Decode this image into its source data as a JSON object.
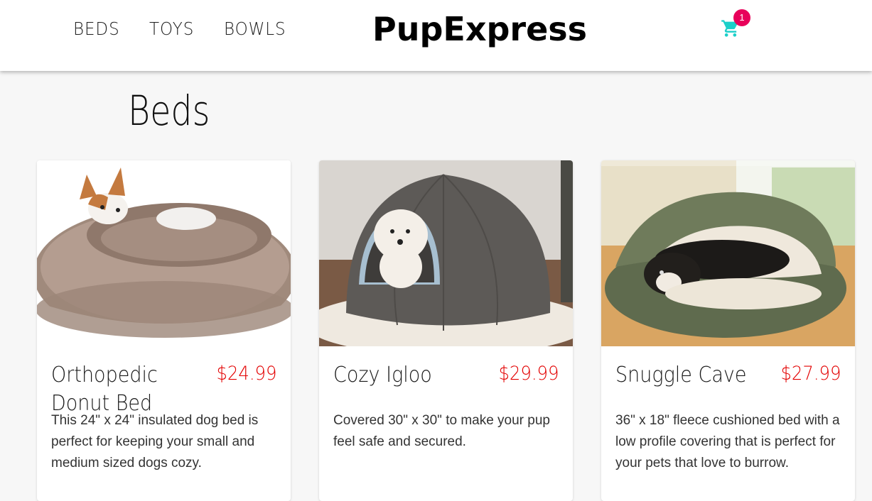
{
  "nav": {
    "items": [
      {
        "label": "BEDS"
      },
      {
        "label": "TOYS"
      },
      {
        "label": "BOWLS"
      }
    ]
  },
  "brand": {
    "name": "PupExpress"
  },
  "cart": {
    "count": "1",
    "icon": "shopping-cart-icon",
    "color": "#1ccfc9",
    "badge_color": "#e8005a"
  },
  "page": {
    "title": "Beds"
  },
  "products": [
    {
      "name": "Orthopedic Donut Bed",
      "price": "$24.99",
      "description": "This 24\" x 24\" insulated dog bed is perfect for keeping your small and medium sized dogs cozy."
    },
    {
      "name": "Cozy Igloo",
      "price": "$29.99",
      "description": "Covered 30\" x 30\" to make your pup feel safe and secured."
    },
    {
      "name": "Snuggle Cave",
      "price": "$27.99",
      "description": "36\" x 18\" fleece cushioned bed with a low profile covering that is perfect for your pets that love to burrow."
    }
  ],
  "colors": {
    "price": "#e30000",
    "background": "#f7f7f7"
  }
}
